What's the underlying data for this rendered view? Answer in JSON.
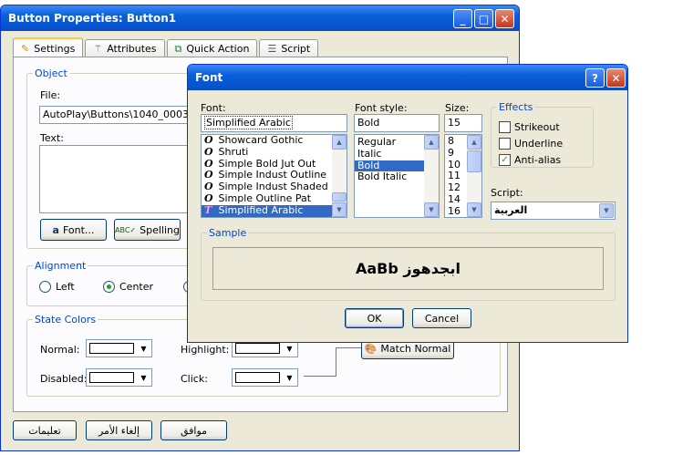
{
  "main_window": {
    "title": "Button Properties: Button1",
    "tabs": [
      {
        "label": "Settings",
        "icon": "pencil-icon"
      },
      {
        "label": "Attributes",
        "icon": "wand-icon"
      },
      {
        "label": "Quick Action",
        "icon": "quick-action-icon"
      },
      {
        "label": "Script",
        "icon": "script-icon"
      }
    ],
    "object_group": "Object",
    "file_label": "File:",
    "file_value": "AutoPlay\\Buttons\\1040_0003.btn",
    "text_label": "Text:",
    "font_button": "Font...",
    "spelling_button": "Spelling",
    "alignment_group": "Alignment",
    "align_left": "Left",
    "align_center": "Center",
    "state_colors_group": "State Colors",
    "normal_label": "Normal:",
    "highlight_label": "Highlight:",
    "disabled_label": "Disabled:",
    "click_label": "Click:",
    "match_normal_button": "Match Normal",
    "ok_button": "موافق",
    "cancel_button": "إلغاء الأمر",
    "help_button": "تعليمات"
  },
  "font_dialog": {
    "title": "Font",
    "font_label": "Font:",
    "font_value": "Simplified Arabic",
    "fonts": [
      "Showcard Gothic",
      "Shruti",
      "Simple Bold Jut Out",
      "Simple Indust Outline",
      "Simple Indust Shaded",
      "Simple Outline Pat",
      "Simplified Arabic"
    ],
    "style_label": "Font style:",
    "style_value": "Bold",
    "styles": [
      "Regular",
      "Italic",
      "Bold",
      "Bold Italic"
    ],
    "size_label": "Size:",
    "size_value": "15",
    "sizes": [
      "8",
      "9",
      "10",
      "11",
      "12",
      "14",
      "16"
    ],
    "effects_label": "Effects",
    "strikeout": "Strikeout",
    "underline": "Underline",
    "antialias": "Anti-alias",
    "script_label": "Script:",
    "script_value": "العربية",
    "sample_label": "Sample",
    "sample_text": "AaBb ابجدهوز",
    "ok": "OK",
    "cancel": "Cancel"
  }
}
